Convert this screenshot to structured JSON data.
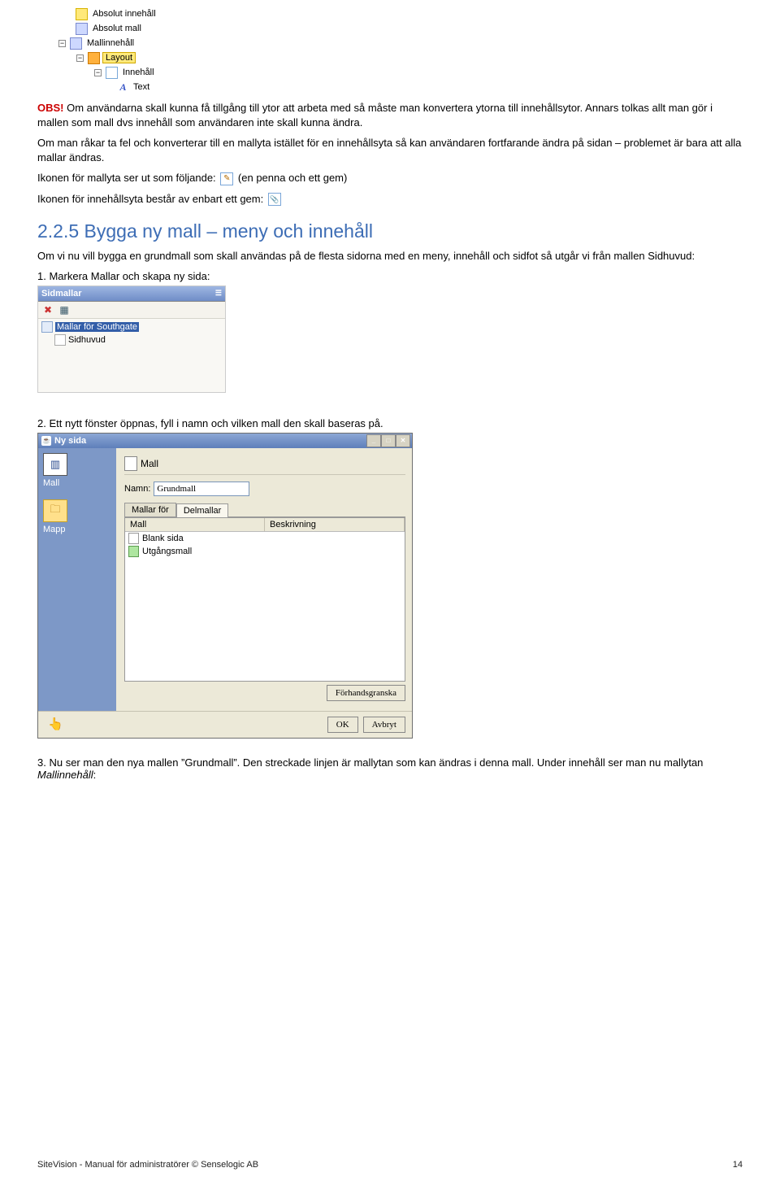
{
  "tree": {
    "items": [
      {
        "label": "Absolut innehåll",
        "indent": 1,
        "icon": "yellowbox"
      },
      {
        "label": "Absolut mall",
        "indent": 1,
        "icon": "bluegrid"
      },
      {
        "label": "Mallinnehåll",
        "indent": 0,
        "toggle": "−",
        "icon": "bluegrid"
      },
      {
        "label": "Layout",
        "indent": 1,
        "toggle": "−",
        "icon": "orange",
        "selected": true
      },
      {
        "label": "Innehåll",
        "indent": 2,
        "toggle": "−",
        "icon": "bluesheet"
      },
      {
        "label": "Text",
        "indent": 3,
        "icon": "text"
      }
    ]
  },
  "obs_label": "OBS!",
  "obs_para": "Om användarna skall kunna få tillgång till ytor att arbeta med så måste man konvertera ytorna till innehållsytor. Annars tolkas allt man gör i mallen som mall dvs innehåll som användaren inte skall kunna ändra.",
  "para2": "Om man råkar ta fel och konverterar till en mallyta istället för en innehållsyta så kan användaren fortfarande ändra på sidan – problemet är bara att alla mallar ändras.",
  "para3_a": "Ikonen för mallyta ser ut som följande:",
  "para3_b": "(en penna och ett gem)",
  "para4": "Ikonen för innehållsyta består av enbart ett gem:",
  "heading": "2.2.5 Bygga ny mall – meny och innehåll",
  "para5": "Om vi nu vill bygga en grundmall som skall användas på de flesta sidorna med en meny, innehåll och sidfot så utgår vi från mallen Sidhuvud:",
  "steps": {
    "s1n": "1.",
    "s1": "Markera Mallar och skapa ny sida:",
    "s2n": "2.",
    "s2": "Ett nytt fönster öppnas, fyll i namn och vilken mall den skall baseras på.",
    "s3n": "3.",
    "s3": "Nu ser man den nya mallen ”Grundmall”. Den streckade linjen är mallytan som kan ändras i denna mall. Under innehåll ser man nu mallytan Mallinnehåll:"
  },
  "sidmallar": {
    "title": "Sidmallar",
    "root": "Mallar för Southgate",
    "child": "Sidhuvud"
  },
  "dialog": {
    "title": "Ny sida",
    "side": {
      "mall": "Mall",
      "mapp": "Mapp"
    },
    "mall_section": "Mall",
    "name_label": "Namn:",
    "name_value": "Grundmall",
    "tab1": "Mallar för",
    "tab2": "Delmallar",
    "col_mall": "Mall",
    "col_desc": "Beskrivning",
    "row1": "Blank sida",
    "row2": "Utgångsmall",
    "preview": "Förhandsgranska",
    "ok": "OK",
    "cancel": "Avbryt"
  },
  "footer": {
    "left": "SiteVision - Manual för administratörer © Senselogic AB",
    "right": "14"
  }
}
